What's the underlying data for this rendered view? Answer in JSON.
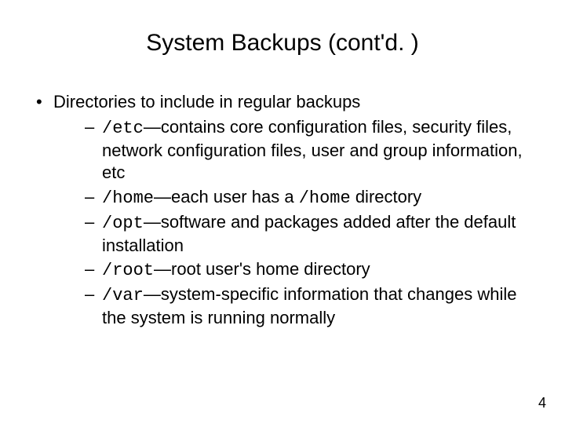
{
  "title": "System Backups (cont'd. )",
  "bullet1": "Directories to include in regular backups",
  "items": [
    {
      "code": "/etc",
      "dash": "—",
      "rest": "contains core configuration files, security files, network configuration files, user and group information, etc",
      "code2": ""
    },
    {
      "code": "/home",
      "dash": "—",
      "rest_a": "each user has a ",
      "code2": "/home",
      "rest_b": " directory"
    },
    {
      "code": "/opt",
      "dash": "—",
      "rest": "software and packages added after the default installation",
      "code2": ""
    },
    {
      "code": "/root",
      "dash": "—",
      "rest": "root user's home directory",
      "code2": ""
    },
    {
      "code": "/var",
      "dash": "—",
      "rest": "system-specific information that changes while the system is running normally",
      "code2": ""
    }
  ],
  "page_number": "4"
}
